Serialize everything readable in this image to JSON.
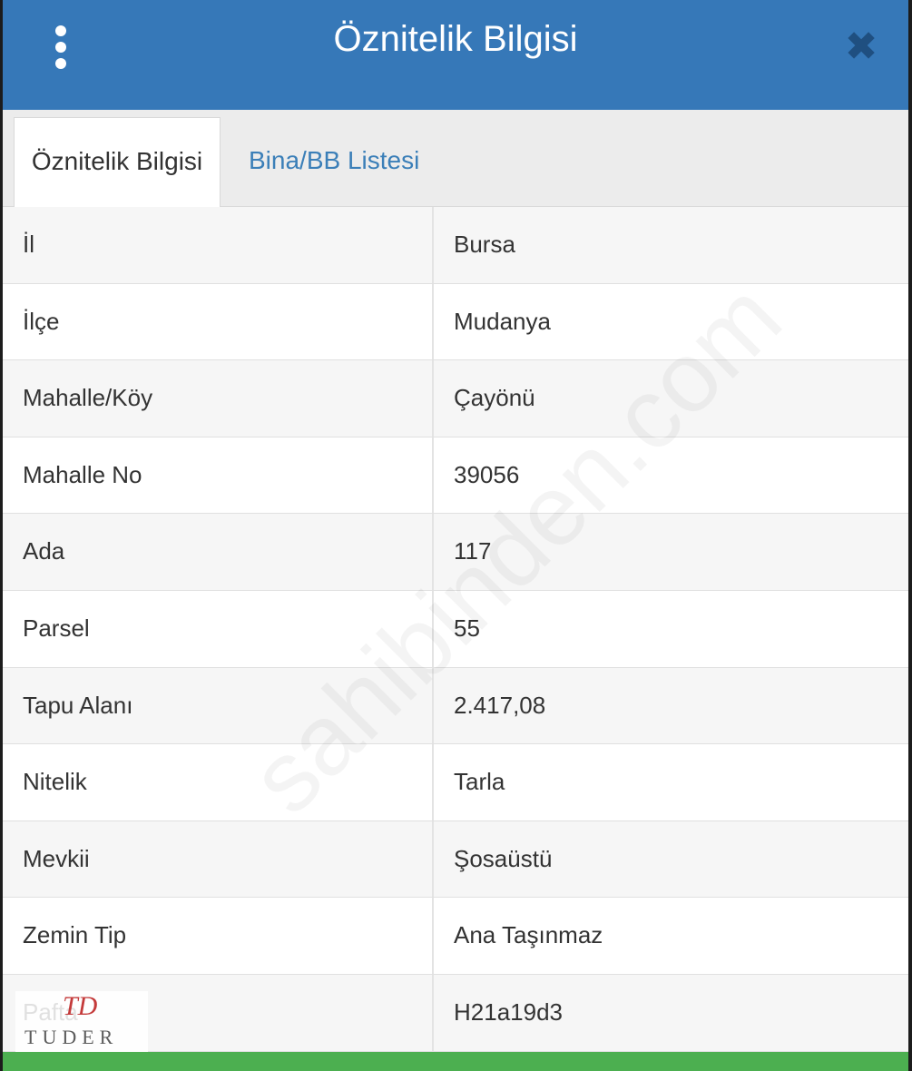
{
  "header": {
    "title": "Öznitelik Bilgisi",
    "menu_icon": "more-vertical-icon",
    "close_icon": "close-icon",
    "close_glyph": "✖",
    "background": "#3678b8"
  },
  "tabs": [
    {
      "label": "Öznitelik Bilgisi",
      "active": true
    },
    {
      "label": "Bina/BB Listesi",
      "active": false
    }
  ],
  "rows": [
    {
      "key": "İl",
      "value": "Bursa"
    },
    {
      "key": "İlçe",
      "value": "Mudanya"
    },
    {
      "key": "Mahalle/Köy",
      "value": "Çayönü"
    },
    {
      "key": "Mahalle No",
      "value": "39056"
    },
    {
      "key": "Ada",
      "value": "117"
    },
    {
      "key": "Parsel",
      "value": "55"
    },
    {
      "key": "Tapu Alanı",
      "value": "2.417,08"
    },
    {
      "key": "Nitelik",
      "value": "Tarla"
    },
    {
      "key": "Mevkii",
      "value": "Şosaüstü"
    },
    {
      "key": "Zemin Tip",
      "value": "Ana Taşınmaz"
    },
    {
      "key": "Pafta",
      "value": "H21a19d3"
    }
  ],
  "watermark": {
    "text": "sahibinden.com"
  },
  "logo": {
    "text": "TUDER",
    "mark": "TD"
  },
  "colors": {
    "accent": "#3678b8",
    "tab_link": "#3b7fb8",
    "footer": "#4caf50"
  }
}
